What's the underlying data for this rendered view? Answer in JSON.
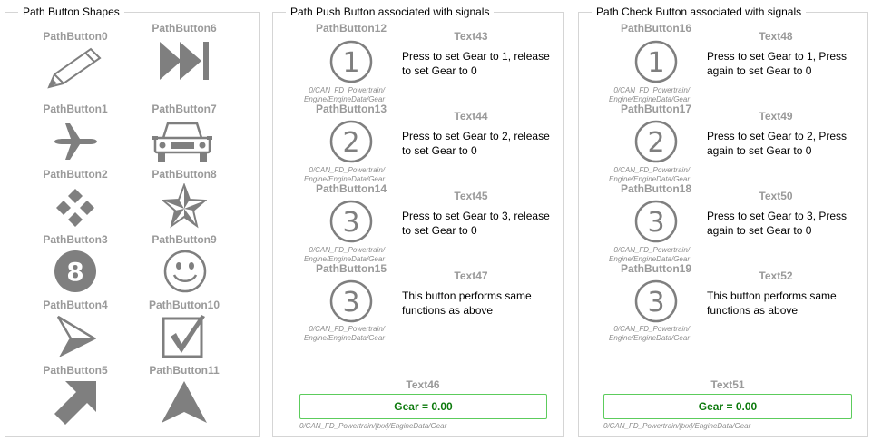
{
  "shapes_panel": {
    "title": "Path Button Shapes",
    "buttons": [
      {
        "label": "PathButton0",
        "icon": "pencil-icon"
      },
      {
        "label": "PathButton6",
        "icon": "skip-forward-icon"
      },
      {
        "label": "PathButton1",
        "icon": "airplane-icon"
      },
      {
        "label": "PathButton7",
        "icon": "car-icon"
      },
      {
        "label": "PathButton2",
        "icon": "diamond-cluster-icon"
      },
      {
        "label": "PathButton8",
        "icon": "star-icon"
      },
      {
        "label": "PathButton3",
        "icon": "number-eight-icon"
      },
      {
        "label": "PathButton9",
        "icon": "smiley-icon"
      },
      {
        "label": "PathButton4",
        "icon": "send-arrow-icon"
      },
      {
        "label": "PathButton10",
        "icon": "checkbox-icon"
      },
      {
        "label": "PathButton5",
        "icon": "arrow-up-right-icon"
      },
      {
        "label": "PathButton11",
        "icon": "navigation-arrow-icon"
      }
    ]
  },
  "push_panel": {
    "title": "Path Push Button associated with signals",
    "rows": [
      {
        "button": "PathButton12",
        "digit": "1",
        "text_label": "Text43",
        "desc": "Press to set Gear to 1, release to set Gear to 0",
        "signal": "0/CAN_FD_Powertrain/ Engine/EngineData/Gear"
      },
      {
        "button": "PathButton13",
        "digit": "2",
        "text_label": "Text44",
        "desc": "Press to set Gear to 2, release to set Gear to 0",
        "signal": "0/CAN_FD_Powertrain/ Engine/EngineData/Gear"
      },
      {
        "button": "PathButton14",
        "digit": "3",
        "text_label": "Text45",
        "desc": "Press to set Gear to 3, release to set Gear to 0",
        "signal": "0/CAN_FD_Powertrain/ Engine/EngineData/Gear"
      },
      {
        "button": "PathButton15",
        "digit": "3",
        "text_label": "Text47",
        "desc": "This button performs same functions as above",
        "signal": "0/CAN_FD_Powertrain/ Engine/EngineData/Gear"
      }
    ],
    "gear_text_label": "Text46",
    "gear_value": "Gear = 0.00",
    "gear_signal": "0/CAN_FD_Powertrain/[txx]/EngineData/Gear"
  },
  "check_panel": {
    "title": "Path Check Button associated with signals",
    "rows": [
      {
        "button": "PathButton16",
        "digit": "1",
        "text_label": "Text48",
        "desc": "Press to set Gear to 1, Press again to set Gear to 0",
        "signal": "0/CAN_FD_Powertrain/ Engine/EngineData/Gear"
      },
      {
        "button": "PathButton17",
        "digit": "2",
        "text_label": "Text49",
        "desc": "Press to set Gear to 2, Press again to set Gear to 0",
        "signal": "0/CAN_FD_Powertrain/ Engine/EngineData/Gear"
      },
      {
        "button": "PathButton18",
        "digit": "3",
        "text_label": "Text50",
        "desc": "Press to set Gear to 3, Press again to set Gear to 0",
        "signal": "0/CAN_FD_Powertrain/ Engine/EngineData/Gear"
      },
      {
        "button": "PathButton19",
        "digit": "3",
        "text_label": "Text52",
        "desc": "This button performs same functions as above",
        "signal": "0/CAN_FD_Powertrain/ Engine/EngineData/Gear"
      }
    ],
    "gear_text_label": "Text51",
    "gear_value": "Gear = 0.00",
    "gear_signal": "0/CAN_FD_Powertrain/[txx]/EngineData/Gear"
  },
  "colors": {
    "icon_gray": "#7f7f7f",
    "label_gray": "#9a9a9a",
    "gear_green_text": "#0d7a0d",
    "gear_green_border": "#5ccc5c"
  }
}
